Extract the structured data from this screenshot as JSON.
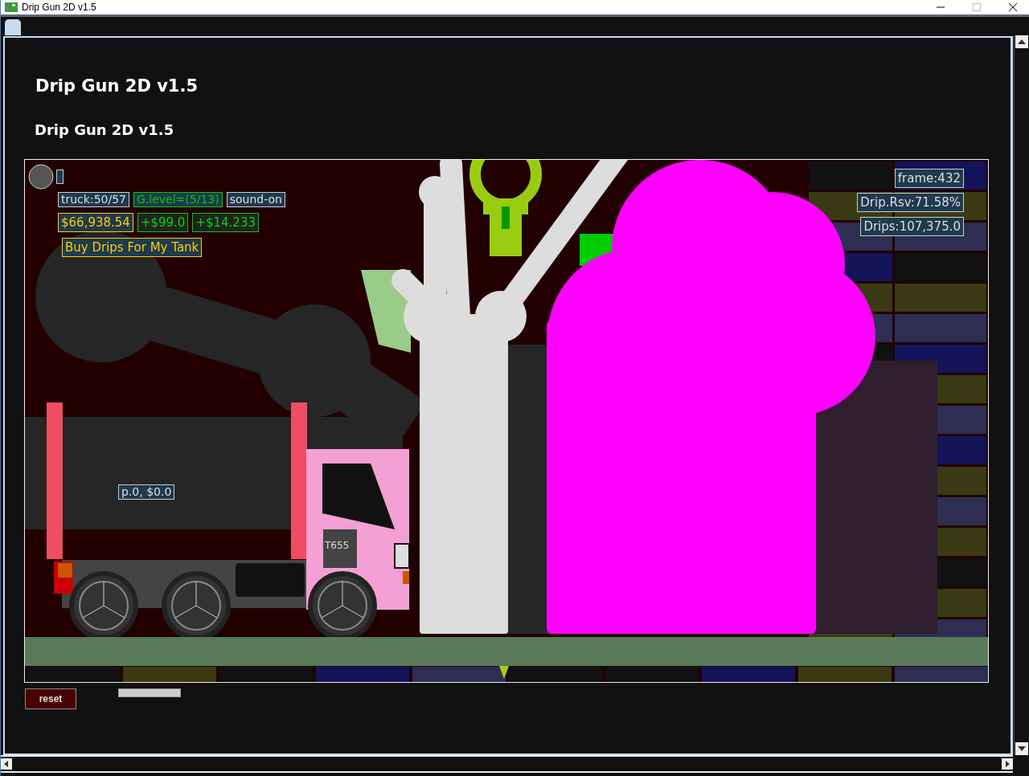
{
  "window": {
    "title": "Drip Gun 2D v1.5"
  },
  "headings": [
    "Drip Gun 2D v1.5",
    "Drip Gun 2D v1.5"
  ],
  "hud": {
    "truck": "truck:50/57",
    "level": "G.level=(5/13)",
    "sound": "sound-on",
    "money": "$66,938.54",
    "gains": [
      "+$99.0",
      "+$14.233"
    ],
    "buy_button": "Buy Drips For My Tank",
    "frame": "frame:432",
    "reserve": "Drip.Rsv:71.58%",
    "drips": "Drips:107,375.0"
  },
  "player_label": "p.0, $0.0",
  "truck_plate": "T655",
  "reset_button": "reset"
}
